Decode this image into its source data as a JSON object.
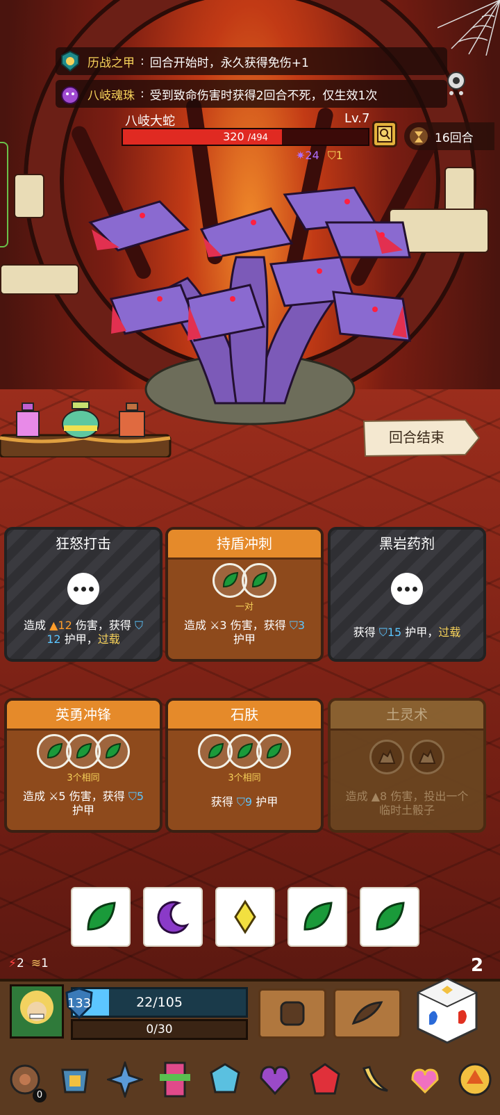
{
  "relic_bar": [
    {
      "name": "历战之甲",
      "desc": "回合开始时，永久获得免伤+1"
    },
    {
      "name": "八岐魂珠",
      "desc": "受到致命伤害时获得2回合不死，仅生效1次"
    }
  ],
  "boss": {
    "name": "八岐大蛇",
    "level": "Lv.7",
    "hp_current": "320",
    "hp_max": "/494",
    "hp_fraction": 0.648,
    "status_poison": "24",
    "status_shield": "1"
  },
  "round_counter": "16回合",
  "end_turn_label": "回合结束",
  "cards": [
    {
      "title": "狂怒打击",
      "line1": "造成",
      "dmg": "12",
      "line1b": "伤害，获得",
      "line2_val": "12",
      "line2": "护甲，",
      "kw": "过载"
    },
    {
      "title": "持盾冲刺",
      "cond": "一对",
      "pre": "造成",
      "dmg": "3",
      "mid": "伤害，获得",
      "armor": "3",
      "post": "护甲"
    },
    {
      "title": "黑岩药剂",
      "pre": "获得",
      "armor": "15",
      "mid": "护甲，",
      "kw": "过载"
    },
    {
      "title": "英勇冲锋",
      "cond": "3个相同",
      "pre": "造成",
      "dmg": "5",
      "mid": "伤害，获得",
      "armor": "5",
      "post": "护甲"
    },
    {
      "title": "石肤",
      "cond": "3个相同",
      "pre": "获得",
      "armor": "9",
      "post": "护甲"
    },
    {
      "title": "土灵术",
      "pre": "造成",
      "dmg": "8",
      "mid": "伤害，投出一个",
      "post": "临时土骰子"
    }
  ],
  "player": {
    "buff_rage": "2",
    "buff_wind": "1",
    "shield": "133",
    "hp": "22/105",
    "hp_fraction": 0.21,
    "xp": "0/30",
    "dice_count": "2",
    "relic_count": "0"
  },
  "colors": {
    "accent_orange": "#e58a2a",
    "hp_red": "#e02a22",
    "armor_blue": "#5cc6ff",
    "keyword_yellow": "#f7d25a"
  }
}
